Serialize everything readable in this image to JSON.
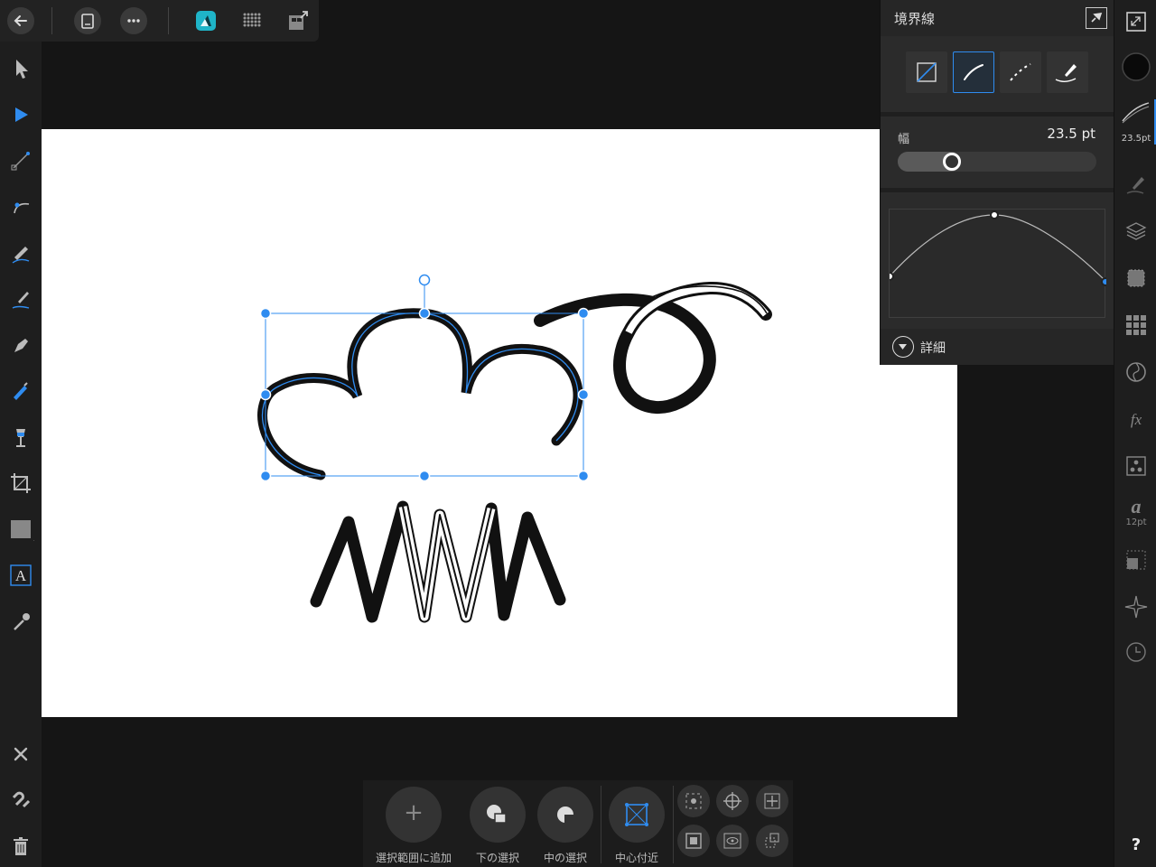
{
  "panel": {
    "title": "境界線",
    "width_label": "幅",
    "width_value": "23.5 pt",
    "width_fraction": 0.25,
    "details_label": "詳細",
    "stroke_styles": [
      "none-style",
      "solid-style",
      "dashed-style",
      "brush-style"
    ],
    "active_style": "solid-style"
  },
  "rightbar": {
    "stroke_value": "23.5pt",
    "text_value": "12pt",
    "help_label": "?"
  },
  "bottombar": {
    "add_selection_label": "選択範囲に追加",
    "select_below_label": "下の選択",
    "select_mid_label": "中の選択",
    "near_center_label": "中心付近",
    "add_symbol": "+"
  },
  "colors": {
    "accent": "#2f8cf0",
    "teal": "#1fb4c8",
    "canvas": "#ffffff",
    "stroke": "#111111"
  }
}
